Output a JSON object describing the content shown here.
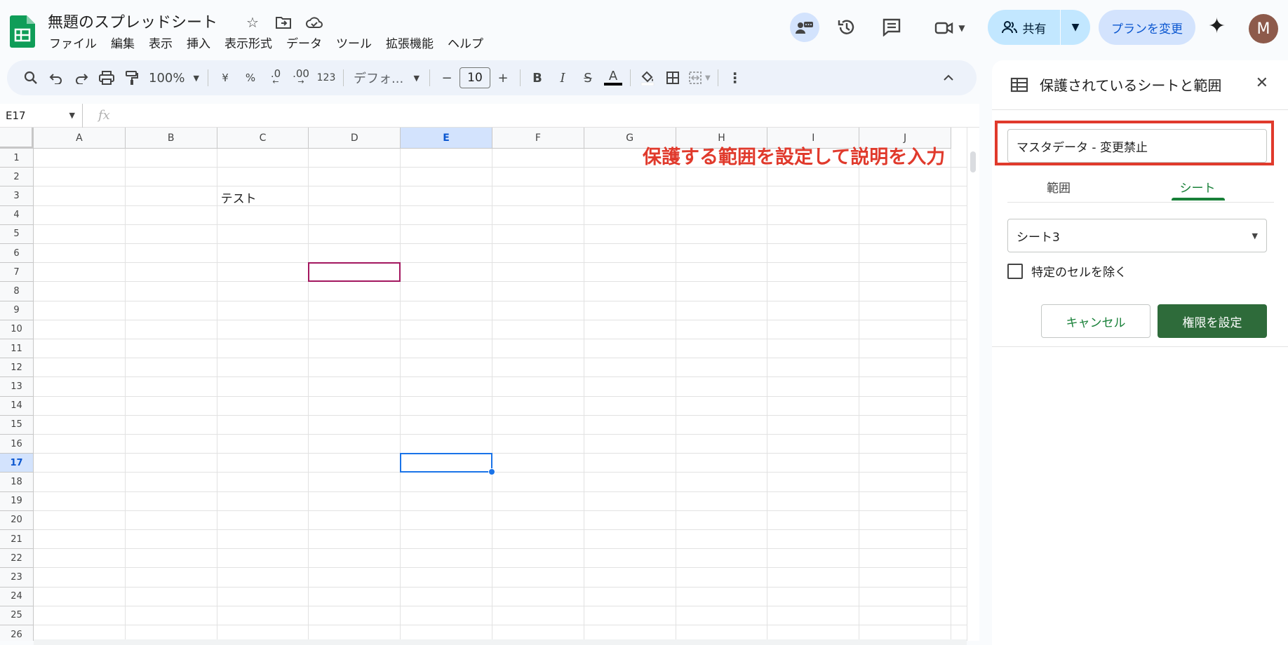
{
  "app": {
    "doc_title": "無題のスプレッドシート",
    "menu": [
      "ファイル",
      "編集",
      "表示",
      "挿入",
      "表示形式",
      "データ",
      "ツール",
      "拡張機能",
      "ヘルプ"
    ],
    "share_label": "共有",
    "plan_label": "プランを変更",
    "avatar_letter": "M",
    "brand_color": "#188038",
    "accent_color": "#0b57d0",
    "annotation_color": "#e03a2c"
  },
  "toolbar": {
    "zoom": "100%",
    "currency": "¥",
    "percent": "%",
    "dec_decrease": ".0",
    "dec_increase": ".00",
    "number_format": "123",
    "font": "デフォ...",
    "font_size": "10",
    "bold": "B",
    "italic": "I",
    "strike": "S",
    "text_color": "A"
  },
  "formula_bar": {
    "cell_ref": "E17",
    "fx": "fx"
  },
  "sheet": {
    "columns": [
      "A",
      "B",
      "C",
      "D",
      "E",
      "F",
      "G",
      "H",
      "I",
      "J"
    ],
    "rows": [
      "1",
      "2",
      "3",
      "4",
      "5",
      "6",
      "7",
      "8",
      "9",
      "10",
      "11",
      "12",
      "13",
      "14",
      "15",
      "16",
      "17",
      "18",
      "19",
      "20",
      "21",
      "22",
      "23",
      "24",
      "25",
      "26"
    ],
    "selected_column": "E",
    "selected_row": "17",
    "cell_c3": "テスト"
  },
  "annotation": {
    "text": "保護する範囲を設定して説明を入力"
  },
  "panel": {
    "title": "保護されているシートと範囲",
    "description_value": "マスタデータ - 変更禁止",
    "tab_range": "範囲",
    "tab_sheet": "シート",
    "active_tab": "シート",
    "sheet_selected": "シート3",
    "except_label": "特定のセルを除く",
    "except_checked": false,
    "cancel_label": "キャンセル",
    "set_label": "権限を設定"
  }
}
